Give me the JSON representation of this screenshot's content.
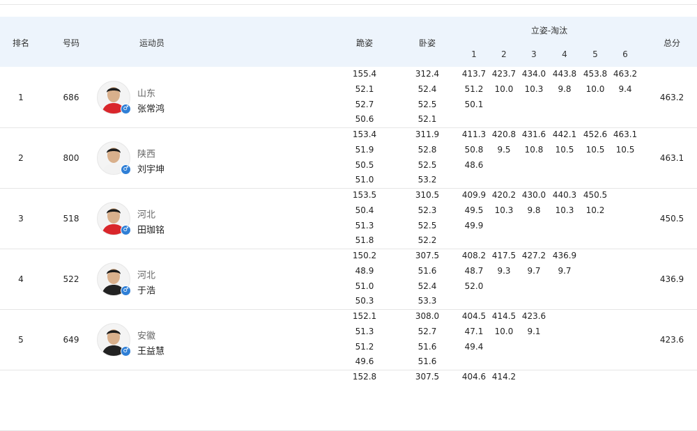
{
  "headers": {
    "rank": "排名",
    "bib": "号码",
    "athlete": "运动员",
    "kneeling": "跪姿",
    "prone": "卧姿",
    "standing_elim": "立姿-淘汰",
    "elim_cols": [
      "1",
      "2",
      "3",
      "4",
      "5",
      "6"
    ],
    "total": "总分"
  },
  "rows": [
    {
      "rank": "1",
      "bib": "686",
      "province": "山东",
      "name": "张常鸿",
      "gender_icon": "♂",
      "jersey": "#d9262b",
      "kneeling": [
        "155.4",
        "52.1",
        "52.7",
        "50.6"
      ],
      "prone": [
        "312.4",
        "52.4",
        "52.5",
        "52.1"
      ],
      "elim": [
        [
          "413.7",
          "51.2",
          "50.1"
        ],
        [
          "423.7",
          "10.0"
        ],
        [
          "434.0",
          "10.3"
        ],
        [
          "443.8",
          "9.8"
        ],
        [
          "453.8",
          "10.0"
        ],
        [
          "463.2",
          "9.4"
        ]
      ],
      "total": "463.2"
    },
    {
      "rank": "2",
      "bib": "800",
      "province": "陕西",
      "name": "刘宇坤",
      "gender_icon": "♂",
      "jersey": "#f2f2f2",
      "kneeling": [
        "153.4",
        "51.9",
        "50.5",
        "51.0"
      ],
      "prone": [
        "311.9",
        "52.8",
        "52.5",
        "53.2"
      ],
      "elim": [
        [
          "411.3",
          "50.8",
          "48.6"
        ],
        [
          "420.8",
          "9.5"
        ],
        [
          "431.6",
          "10.8"
        ],
        [
          "442.1",
          "10.5"
        ],
        [
          "452.6",
          "10.5"
        ],
        [
          "463.1",
          "10.5"
        ]
      ],
      "total": "463.1"
    },
    {
      "rank": "3",
      "bib": "518",
      "province": "河北",
      "name": "田珈铭",
      "gender_icon": "♂",
      "jersey": "#d9262b",
      "kneeling": [
        "153.5",
        "50.4",
        "51.3",
        "51.8"
      ],
      "prone": [
        "310.5",
        "52.3",
        "52.5",
        "52.2"
      ],
      "elim": [
        [
          "409.9",
          "49.5",
          "49.9"
        ],
        [
          "420.2",
          "10.3"
        ],
        [
          "430.0",
          "9.8"
        ],
        [
          "440.3",
          "10.3"
        ],
        [
          "450.5",
          "10.2"
        ],
        []
      ],
      "total": "450.5"
    },
    {
      "rank": "4",
      "bib": "522",
      "province": "河北",
      "name": "于浩",
      "gender_icon": "♂",
      "jersey": "#222222",
      "kneeling": [
        "150.2",
        "48.9",
        "51.0",
        "50.3"
      ],
      "prone": [
        "307.5",
        "51.6",
        "52.4",
        "53.3"
      ],
      "elim": [
        [
          "408.2",
          "48.7",
          "52.0"
        ],
        [
          "417.5",
          "9.3"
        ],
        [
          "427.2",
          "9.7"
        ],
        [
          "436.9",
          "9.7"
        ],
        [],
        []
      ],
      "total": "436.9"
    },
    {
      "rank": "5",
      "bib": "649",
      "province": "安徽",
      "name": "王益慧",
      "gender_icon": "♂",
      "jersey": "#222222",
      "kneeling": [
        "152.1",
        "51.3",
        "51.2",
        "49.6"
      ],
      "prone": [
        "308.0",
        "52.7",
        "51.6",
        "51.6"
      ],
      "elim": [
        [
          "404.5",
          "47.1",
          "49.4"
        ],
        [
          "414.5",
          "10.0"
        ],
        [
          "423.6",
          "9.1"
        ],
        [],
        [],
        []
      ],
      "total": "423.6"
    },
    {
      "rank": "",
      "bib": "",
      "province": "",
      "name": "",
      "gender_icon": "",
      "jersey": "#222222",
      "kneeling": [
        "152.8"
      ],
      "prone": [
        "307.5"
      ],
      "elim": [
        [
          "404.6"
        ],
        [
          "414.2"
        ],
        [],
        [],
        [],
        []
      ],
      "total": ""
    }
  ]
}
